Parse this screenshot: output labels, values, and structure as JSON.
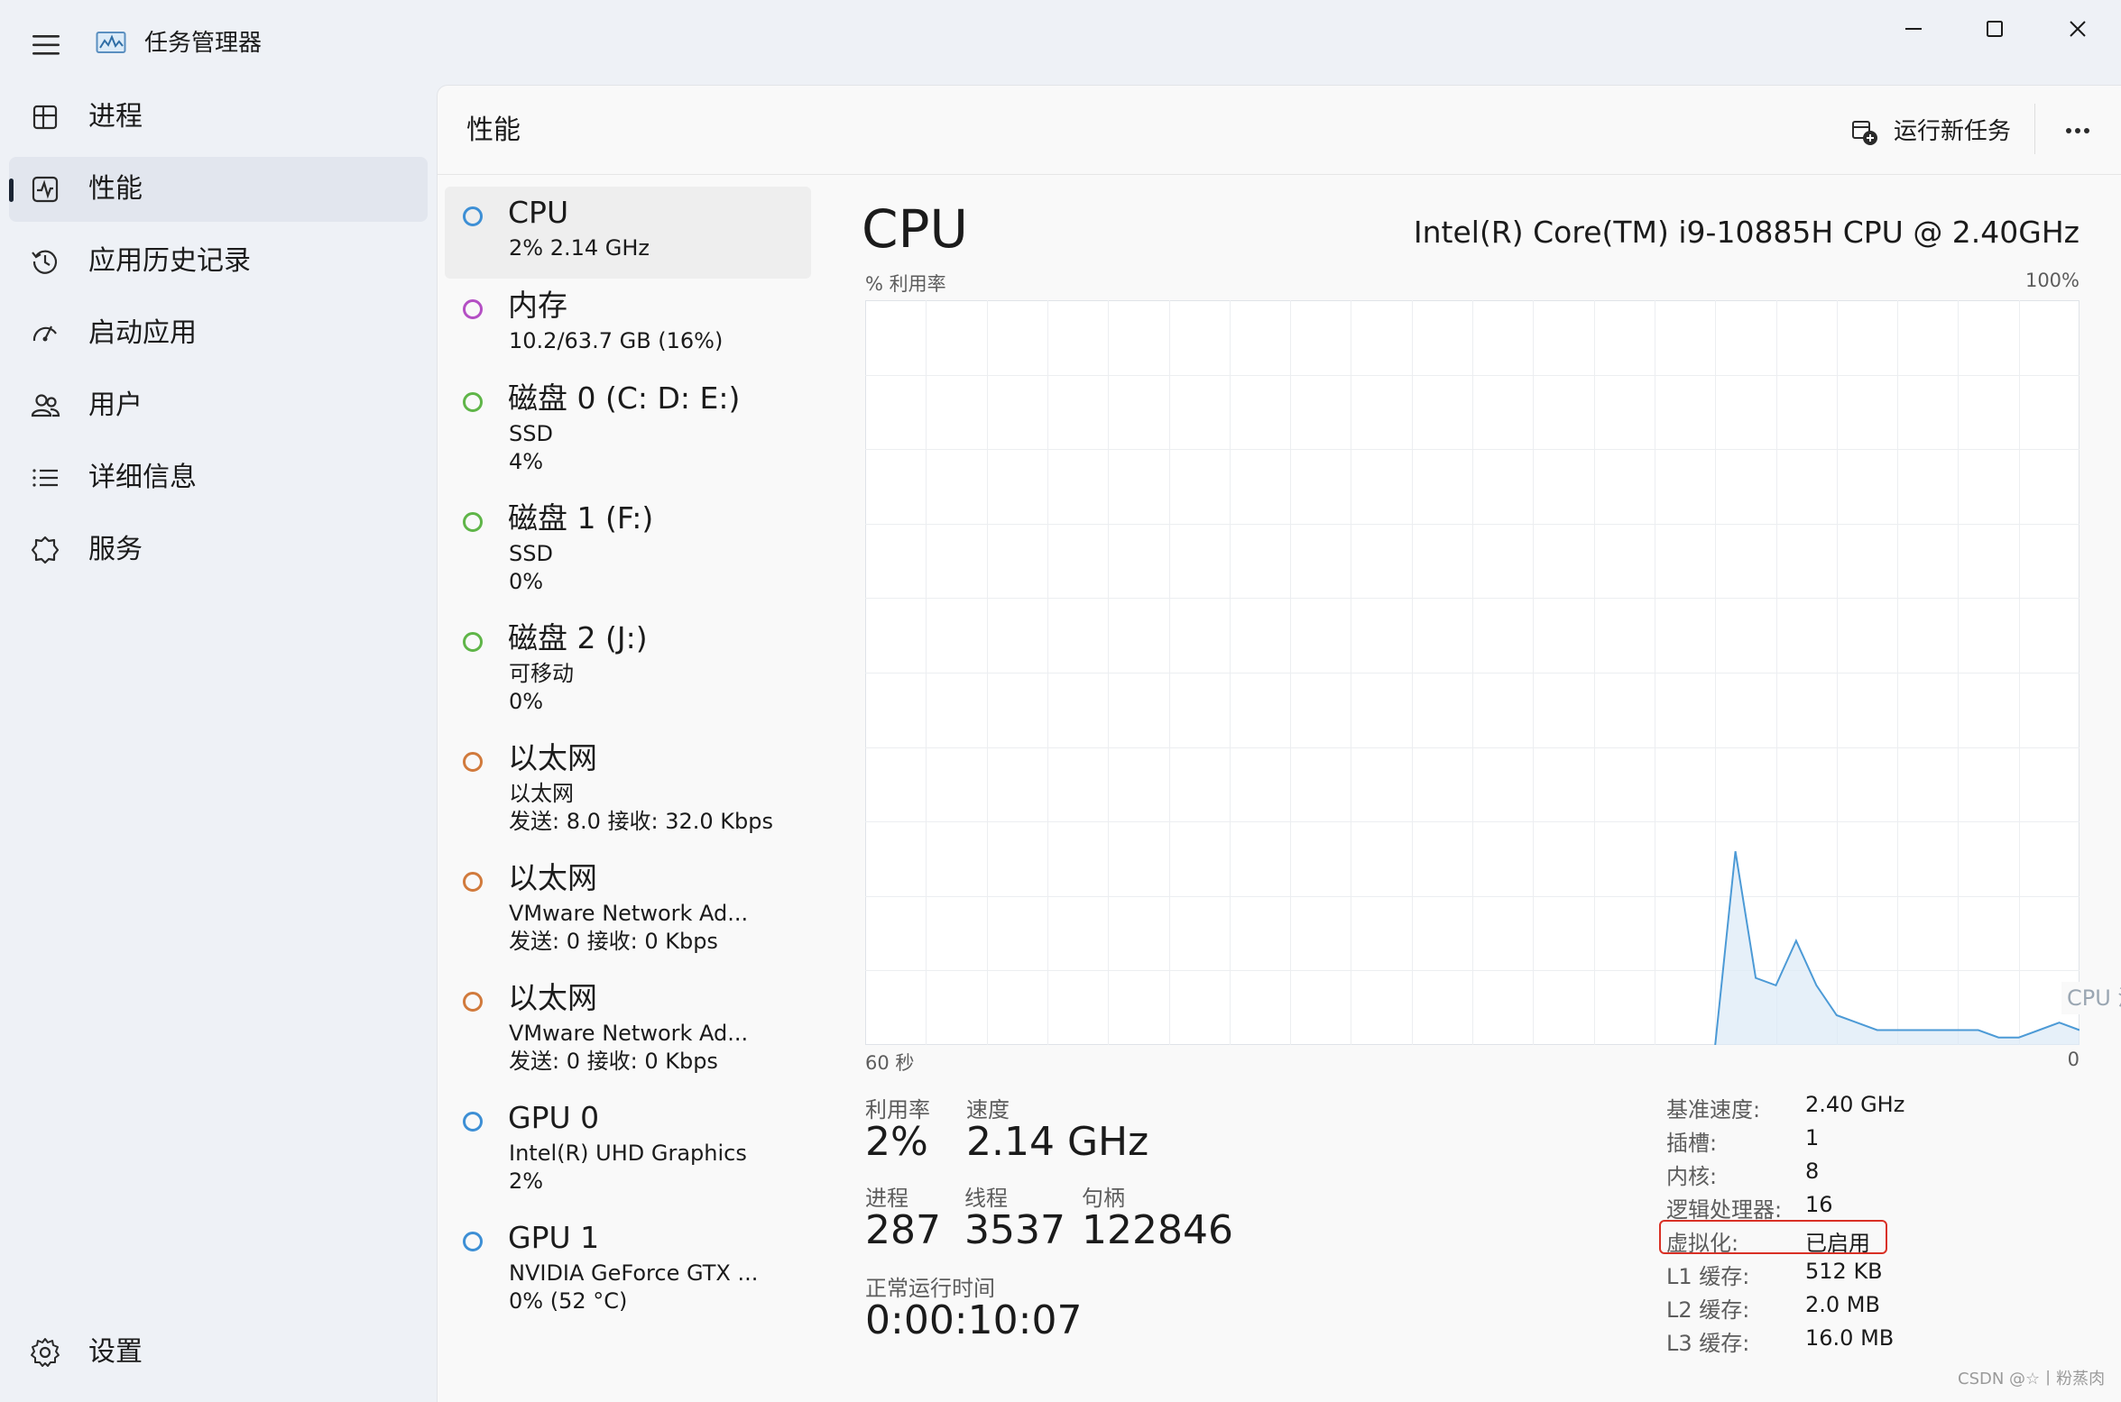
{
  "window": {
    "app_title": "任务管理器",
    "minimize_glyph": "—",
    "colors": {
      "accent": "#3d8fd5",
      "highlight_box": "#d93025",
      "graph_line": "#4c9ad6"
    }
  },
  "sidebar": {
    "items": [
      {
        "label": "进程",
        "icon": "processes-icon"
      },
      {
        "label": "性能",
        "icon": "performance-icon",
        "active": true
      },
      {
        "label": "应用历史记录",
        "icon": "history-icon"
      },
      {
        "label": "启动应用",
        "icon": "startup-icon"
      },
      {
        "label": "用户",
        "icon": "users-icon"
      },
      {
        "label": "详细信息",
        "icon": "details-icon"
      },
      {
        "label": "服务",
        "icon": "services-icon"
      }
    ],
    "settings_label": "设置"
  },
  "header": {
    "title": "性能",
    "run_new_task_label": "运行新任务"
  },
  "devices": [
    {
      "name": "CPU",
      "line2": "2% 2.14 GHz",
      "line3": "",
      "color": "#3d8fd5"
    },
    {
      "name": "内存",
      "line2": "10.2/63.7 GB (16%)",
      "line3": "",
      "color": "#b44fc4"
    },
    {
      "name": "磁盘 0 (C: D: E:)",
      "line2": "SSD",
      "line3": "4%",
      "color": "#5fb548"
    },
    {
      "name": "磁盘 1 (F:)",
      "line2": "SSD",
      "line3": "0%",
      "color": "#5fb548"
    },
    {
      "name": "磁盘 2 (J:)",
      "line2": "可移动",
      "line3": "0%",
      "color": "#5fb548"
    },
    {
      "name": "以太网",
      "line2": "以太网",
      "line3": "发送: 8.0 接收: 32.0 Kbps",
      "color": "#d17a3c"
    },
    {
      "name": "以太网",
      "line2": "VMware Network Ad...",
      "line3": "发送: 0 接收: 0 Kbps",
      "color": "#d17a3c"
    },
    {
      "name": "以太网",
      "line2": "VMware Network Ad...",
      "line3": "发送: 0 接收: 0 Kbps",
      "color": "#d17a3c"
    },
    {
      "name": "GPU 0",
      "line2": "Intel(R) UHD Graphics",
      "line3": "2%",
      "color": "#3d8fd5"
    },
    {
      "name": "GPU 1",
      "line2": "NVIDIA GeForce GTX ...",
      "line3": "0% (52 °C)",
      "color": "#3d8fd5"
    }
  ],
  "cpu": {
    "title": "CPU",
    "model": "Intel(R) Core(TM) i9-10885H CPU @ 2.40GHz",
    "graph": {
      "y_label": "% 利用率",
      "y_max_label": "100%",
      "x_left_label": "60 秒",
      "x_right_label": "0",
      "overlay_label": "CPU 温"
    },
    "stats": {
      "utilization_label": "利用率",
      "utilization": "2%",
      "speed_label": "速度",
      "speed": "2.14 GHz",
      "processes_label": "进程",
      "processes": "287",
      "threads_label": "线程",
      "threads": "3537",
      "handles_label": "句柄",
      "handles": "122846",
      "uptime_label": "正常运行时间",
      "uptime": "0:00:10:07"
    },
    "details": [
      {
        "label": "基准速度:",
        "value": "2.40 GHz"
      },
      {
        "label": "插槽:",
        "value": "1"
      },
      {
        "label": "内核:",
        "value": "8"
      },
      {
        "label": "逻辑处理器:",
        "value": "16"
      },
      {
        "label": "虚拟化:",
        "value": "已启用",
        "highlighted": true
      },
      {
        "label": "L1 缓存:",
        "value": "512 KB"
      },
      {
        "label": "L2 缓存:",
        "value": "2.0 MB"
      },
      {
        "label": "L3 缓存:",
        "value": "16.0 MB"
      }
    ]
  },
  "chart_data": {
    "type": "area",
    "title": "",
    "xlabel": "60 秒",
    "ylabel": "% 利用率",
    "xlim": [
      60,
      0
    ],
    "ylim": [
      0,
      100
    ],
    "x": [
      60,
      59,
      58,
      57,
      56,
      55,
      54,
      53,
      52,
      51,
      50,
      49,
      48,
      47,
      46,
      45,
      44,
      43,
      42,
      41,
      40,
      39,
      38,
      37,
      36,
      35,
      34,
      33,
      32,
      31,
      30,
      29,
      28,
      27,
      26,
      25,
      24,
      23,
      22,
      21,
      20,
      19,
      18,
      17,
      16,
      15,
      14,
      13,
      12,
      11,
      10,
      9,
      8,
      7,
      6,
      5,
      4,
      3,
      2,
      1,
      0
    ],
    "series": [
      {
        "values": [
          0,
          0,
          0,
          0,
          0,
          0,
          0,
          0,
          0,
          0,
          0,
          0,
          0,
          0,
          0,
          0,
          0,
          0,
          0,
          0,
          0,
          0,
          0,
          0,
          0,
          0,
          0,
          0,
          0,
          0,
          0,
          0,
          0,
          0,
          0,
          0,
          0,
          0,
          0,
          0,
          0,
          0,
          0,
          26,
          9,
          8,
          14,
          8,
          4,
          3,
          2,
          2,
          2,
          2,
          2,
          2,
          1,
          1,
          2,
          3,
          2
        ]
      }
    ]
  },
  "watermark": "CSDN @☆丨粉蒸肉"
}
